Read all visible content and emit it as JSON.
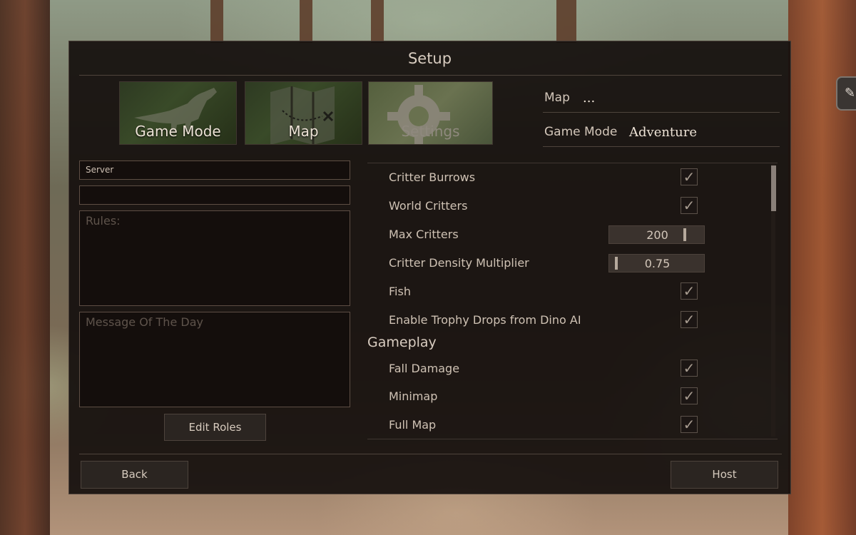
{
  "window": {
    "title": "Setup"
  },
  "tabs": [
    {
      "label": "Game Mode",
      "icon": "dinosaur-icon"
    },
    {
      "label": "Map",
      "icon": "map-icon"
    },
    {
      "label": "Settings",
      "icon": "gear-icon"
    }
  ],
  "info": {
    "map_label": "Map",
    "map_value": "...",
    "game_mode_label": "Game Mode",
    "game_mode_value": "Adventure"
  },
  "server": {
    "name_value": "Server",
    "password_value": "",
    "rules_placeholder": "Rules:",
    "motd_placeholder": "Message Of The Day",
    "edit_roles_label": "Edit Roles"
  },
  "settings": {
    "critter_burrows": {
      "label": "Critter Burrows",
      "checked": true
    },
    "world_critters": {
      "label": "World Critters",
      "checked": true
    },
    "max_critters": {
      "label": "Max Critters",
      "value": "200"
    },
    "critter_density": {
      "label": "Critter Density Multiplier",
      "value": "0.75"
    },
    "fish": {
      "label": "Fish",
      "checked": true
    },
    "trophy_drops": {
      "label": "Enable Trophy Drops from Dino AI",
      "checked": true
    },
    "gameplay_header": "Gameplay",
    "fall_damage": {
      "label": "Fall Damage",
      "checked": true
    },
    "minimap": {
      "label": "Minimap",
      "checked": true
    },
    "full_map": {
      "label": "Full Map",
      "checked": true
    }
  },
  "footer": {
    "back_label": "Back",
    "host_label": "Host"
  },
  "check_glyph": "✓",
  "edge_icon": "pencil-icon",
  "colors": {
    "panel": "#16100e",
    "text": "#d8ccc0",
    "border": "#4e443c"
  }
}
